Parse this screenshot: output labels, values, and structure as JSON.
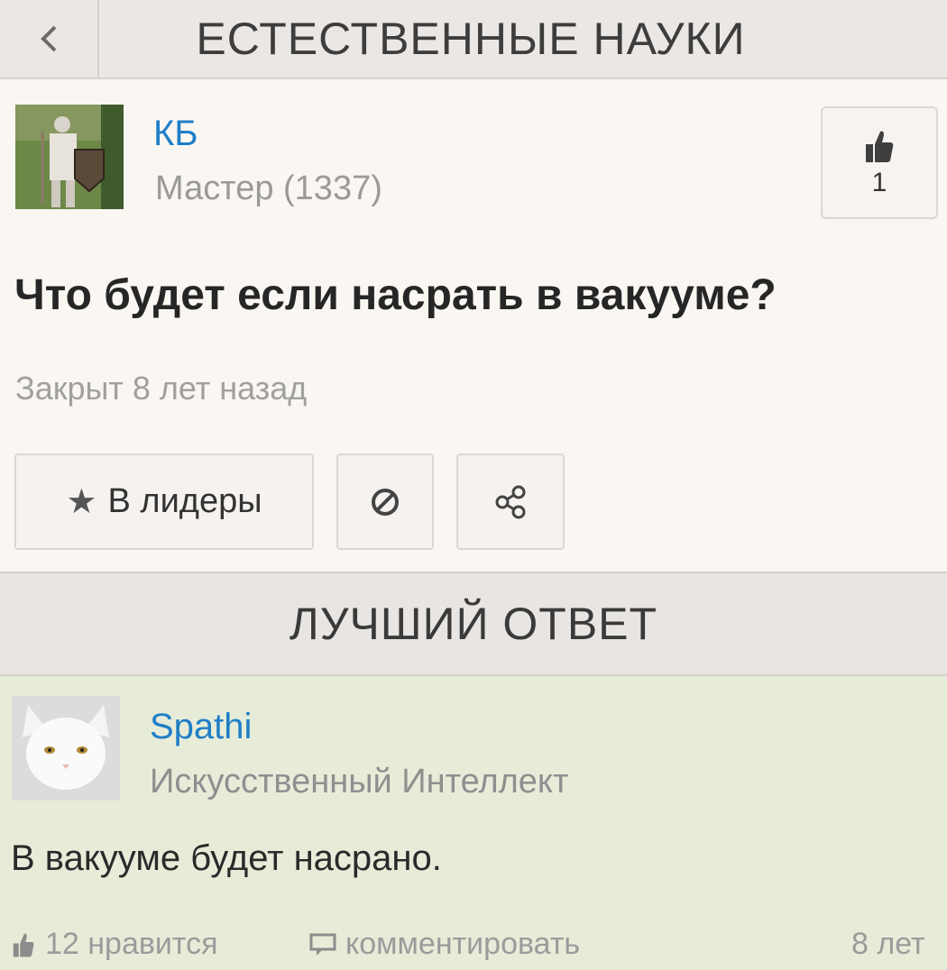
{
  "header": {
    "back_icon": "chevron-left-icon",
    "title": "ЕСТЕСТВЕННЫЕ НАУКИ"
  },
  "question": {
    "author": {
      "name": "КБ",
      "rank": "Мастер (1337)"
    },
    "likes": {
      "icon": "thumbs-up-icon",
      "count": "1"
    },
    "text": "Что будет если насрать в вакууме?",
    "status": "Закрыт 8 лет назад",
    "actions": {
      "leaders_label": "В лидеры",
      "leaders_icon": "star-icon",
      "block_icon": "block-icon",
      "share_icon": "share-icon"
    }
  },
  "best_answer": {
    "section_title": "ЛУЧШИЙ ОТВЕТ",
    "author": {
      "name": "Spathi",
      "rank": "Искусственный Интеллект"
    },
    "text": "В вакууме будет насрано.",
    "footer": {
      "likes_label": "12 нравится",
      "comment_label": "комментировать",
      "time": "8 лет"
    }
  },
  "colors": {
    "link": "#1f7ec6",
    "answer_bg": "#e7ecd9",
    "page_bg": "#faf6f2"
  }
}
